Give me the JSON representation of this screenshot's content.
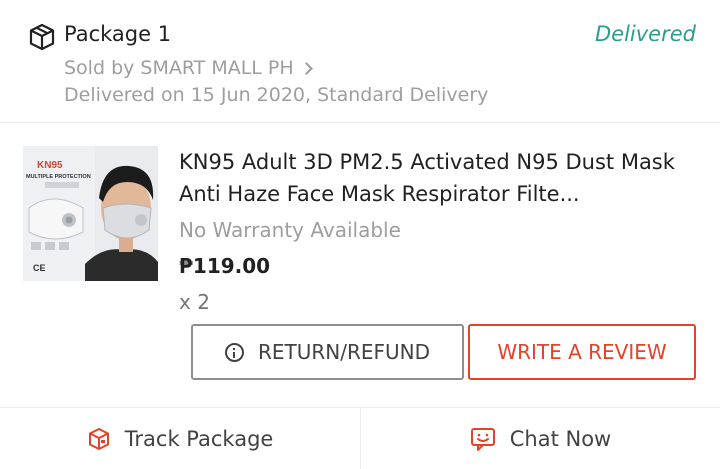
{
  "package": {
    "title": "Package 1",
    "status": "Delivered",
    "seller": "Sold by SMART MALL PH",
    "delivery": "Delivered on 15 Jun 2020, Standard Delivery",
    "icon": "package-box-icon"
  },
  "product": {
    "name": "KN95 Adult 3D PM2.5 Activated N95 Dust Mask Anti Haze Face Mask Respirator Filte...",
    "warranty": "No Warranty Available",
    "price": "₱119.00",
    "quantity": "x 2",
    "image_text": {
      "brand": "KN95",
      "tagline": "MULTIPLE PROTECTION",
      "mark": "CE"
    }
  },
  "actions": {
    "return_label": "RETURN/REFUND",
    "review_label": "WRITE A REVIEW"
  },
  "footer": {
    "track_label": "Track Package",
    "chat_label": "Chat Now"
  },
  "colors": {
    "status": "#2a9d8f",
    "accent": "#e24329",
    "muted": "#9e9e9e"
  }
}
